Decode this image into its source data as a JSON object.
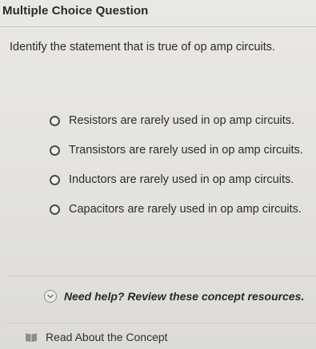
{
  "header": {
    "title": "Multiple Choice Question"
  },
  "question": {
    "text": "Identify the statement that is true of op amp circuits."
  },
  "options": [
    {
      "label": "Resistors are rarely used in op amp circuits.",
      "selected": false
    },
    {
      "label": "Transistors are rarely used in op amp circuits.",
      "selected": false
    },
    {
      "label": "Inductors are rarely used in op amp circuits.",
      "selected": false
    },
    {
      "label": "Capacitors are rarely used in op amp circuits.",
      "selected": false
    }
  ],
  "help": {
    "text": "Need help? Review these concept resources.",
    "icon": "chevron-down-circle-icon",
    "expanded": true
  },
  "resources": {
    "read_concept": "Read About the Concept",
    "icon": "book-icon"
  }
}
